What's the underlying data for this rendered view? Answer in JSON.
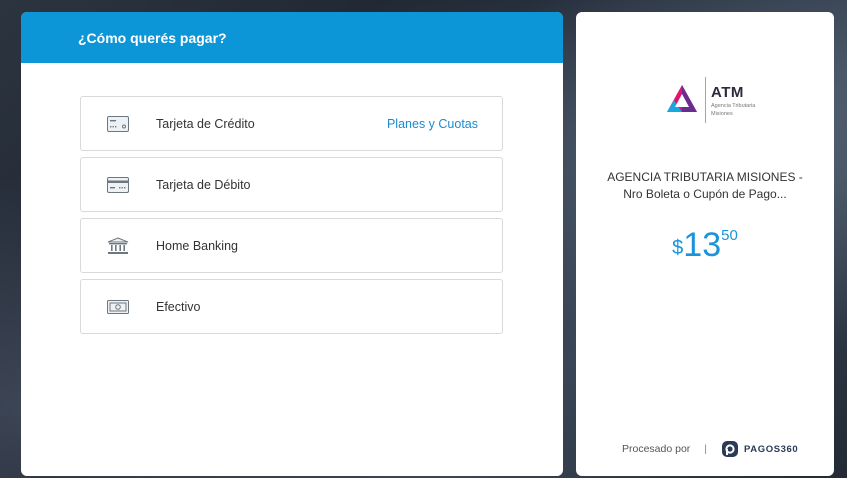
{
  "payment": {
    "title": "¿Cómo querés pagar?",
    "options": [
      {
        "label": "Tarjeta de Crédito",
        "extra": "Planes y Cuotas",
        "icon": "credit-card-icon"
      },
      {
        "label": "Tarjeta de Débito",
        "extra": "",
        "icon": "debit-card-icon"
      },
      {
        "label": "Home Banking",
        "extra": "",
        "icon": "bank-icon"
      },
      {
        "label": "Efectivo",
        "extra": "",
        "icon": "cash-icon"
      }
    ]
  },
  "summary": {
    "logo_text": "ATM",
    "logo_subtext_1": "Agencia Tributaria",
    "logo_subtext_2": "Misiones",
    "merchant_line1": "AGENCIA TRIBUTARIA MISIONES -",
    "merchant_line2": "Nro Boleta o Cupón de Pago...",
    "currency": "$",
    "amount_integer": "13",
    "amount_decimals": "50",
    "processed_by": "Procesado por",
    "separator": "|",
    "brand": "PAGOS360"
  },
  "colors": {
    "accent": "#0c96d8",
    "link": "#1a8ccf",
    "amount": "#1a93d8"
  }
}
